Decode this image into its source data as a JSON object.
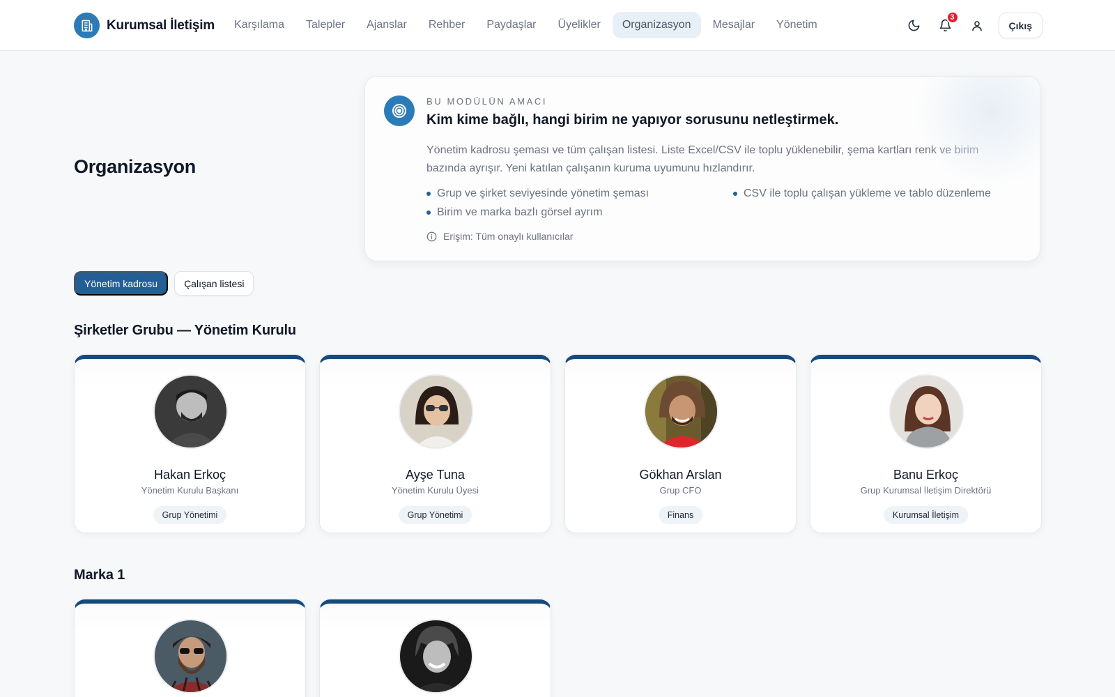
{
  "app": {
    "name": "Kurumsal İletişim",
    "logo_icon": "building-icon",
    "accent": "#2b7bb8",
    "primary_dark": "#174a7c"
  },
  "nav": {
    "items": [
      {
        "label": "Karşılama",
        "active": false
      },
      {
        "label": "Talepler",
        "active": false
      },
      {
        "label": "Ajanslar",
        "active": false
      },
      {
        "label": "Rehber",
        "active": false
      },
      {
        "label": "Paydaşlar",
        "active": false
      },
      {
        "label": "Üyelikler",
        "active": false
      },
      {
        "label": "Organizasyon",
        "active": true
      },
      {
        "label": "Mesajlar",
        "active": false
      },
      {
        "label": "Yönetim",
        "active": false
      }
    ]
  },
  "header": {
    "notification_count": "3",
    "logout_label": "Çıkış",
    "theme_icon": "moon-icon",
    "notification_icon": "bell-icon",
    "profile_icon": "user-icon"
  },
  "page": {
    "title": "Organizasyon"
  },
  "info": {
    "eyebrow": "BU MODÜLÜN AMACI",
    "heading": "Kim kime bağlı, hangi birim ne yapıyor sorusunu netleştirmek.",
    "description": "Yönetim kadrosu şeması ve tüm çalışan listesi. Liste Excel/CSV ile toplu yüklenebilir, şema kartları renk ve birim bazında ayrışır. Yeni katılan çalışanın kuruma uyumunu hızlandırır.",
    "bullets": [
      "Grup ve şirket seviyesinde yönetim şeması",
      "CSV ile toplu çalışan yükleme ve tablo düzenleme",
      "Birim ve marka bazlı görsel ayrım"
    ],
    "access": "Erişim: Tüm onaylı kullanıcılar"
  },
  "tabs": [
    {
      "label": "Yönetim kadrosu",
      "active": true
    },
    {
      "label": "Çalışan listesi",
      "active": false
    }
  ],
  "sections": [
    {
      "title": "Şirketler Grubu — Yönetim Kurulu",
      "people": [
        {
          "name": "Hakan Erkoç",
          "role": "Yönetim Kurulu Başkanı",
          "department": "Grup Yönetimi"
        },
        {
          "name": "Ayşe Tuna",
          "role": "Yönetim Kurulu Üyesi",
          "department": "Grup Yönetimi"
        },
        {
          "name": "Gökhan Arslan",
          "role": "Grup CFO",
          "department": "Finans"
        },
        {
          "name": "Banu Erkoç",
          "role": "Grup Kurumsal İletişim Direktörü",
          "department": "Kurumsal İletişim"
        }
      ]
    },
    {
      "title": "Marka 1",
      "people": [
        {
          "name": "",
          "role": "",
          "department": ""
        },
        {
          "name": "",
          "role": "",
          "department": ""
        }
      ]
    }
  ]
}
